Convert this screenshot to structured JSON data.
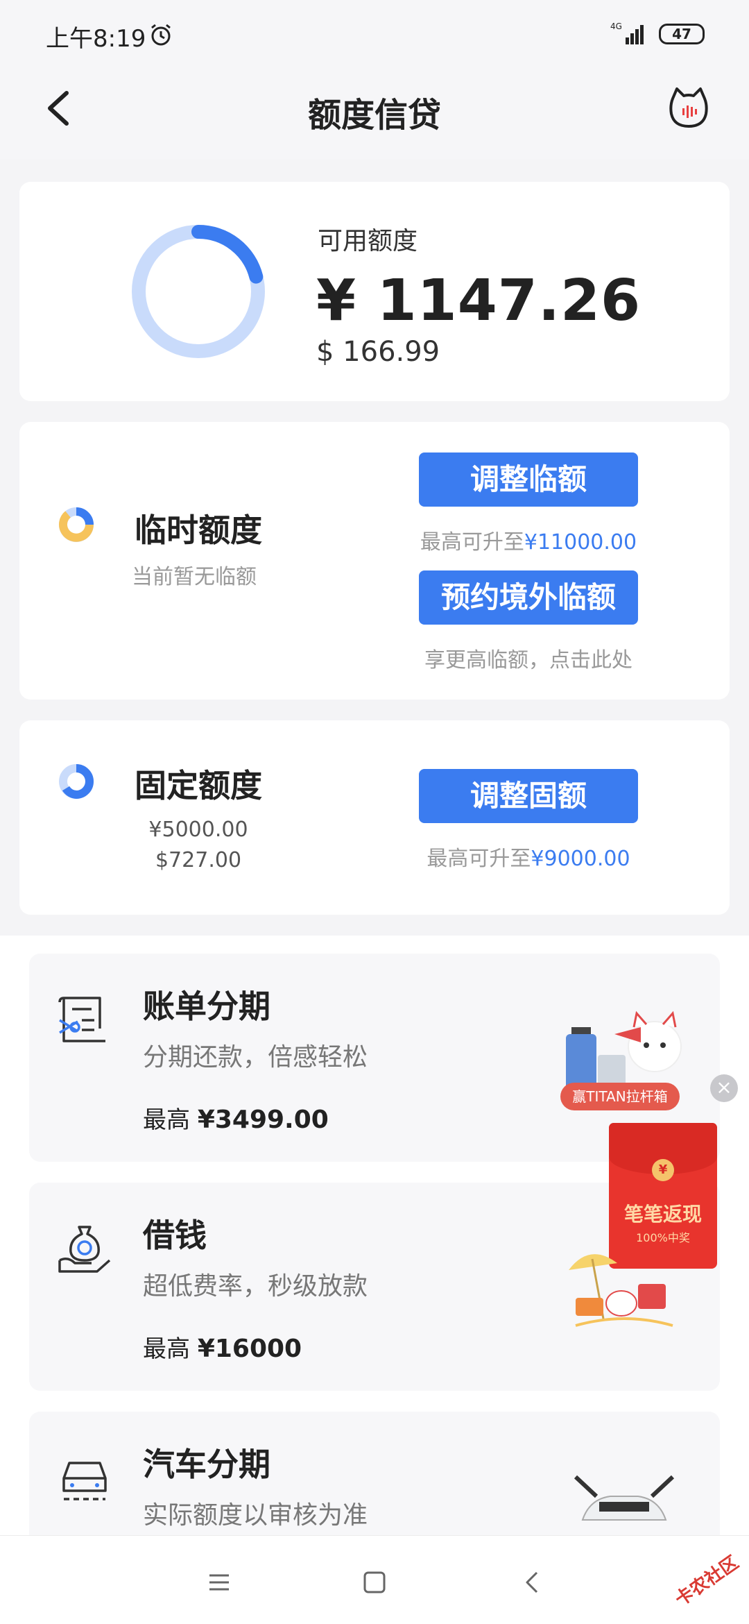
{
  "status_bar": {
    "time": "上午8:19",
    "network": "4G",
    "battery": "47"
  },
  "nav": {
    "title": "额度信贷"
  },
  "available": {
    "label": "可用额度",
    "cny": "¥ 1147.26",
    "usd": "$ 166.99",
    "used_fraction": 0.21
  },
  "temporary": {
    "title": "临时额度",
    "subtitle": "当前暂无临额",
    "adjust_button": "调整临额",
    "adjust_hint_prefix": "最高可升至",
    "adjust_hint_amount": "¥11000.00",
    "reserve_button": "预约境外临额",
    "reserve_hint": "享更高临额，点击此处"
  },
  "fixed": {
    "title": "固定额度",
    "cny": "¥5000.00",
    "usd": "$727.00",
    "adjust_button": "调整固额",
    "adjust_hint_prefix": "最高可升至",
    "adjust_hint_amount": "¥9000.00"
  },
  "products": [
    {
      "title": "账单分期",
      "subtitle": "分期还款，倍感轻松",
      "max_prefix": "最高 ",
      "max_amount": "¥3499.00"
    },
    {
      "title": "借钱",
      "subtitle": "超低费率，秒级放款",
      "max_prefix": "最高 ",
      "max_amount": "¥16000"
    },
    {
      "title": "汽车分期",
      "subtitle": "实际额度以审核为准"
    }
  ],
  "promo": {
    "tag": "赢TITAN拉杆箱",
    "packet_title": "笔笔返现",
    "packet_sub": "100%中奖",
    "coin": "¥"
  },
  "watermark": "卡农社区",
  "colors": {
    "accent": "#3b7cf0",
    "donut_track": "#c9dbfb",
    "temp_pie_yellow": "#f6c35b",
    "red_packet": "#e8342d"
  }
}
